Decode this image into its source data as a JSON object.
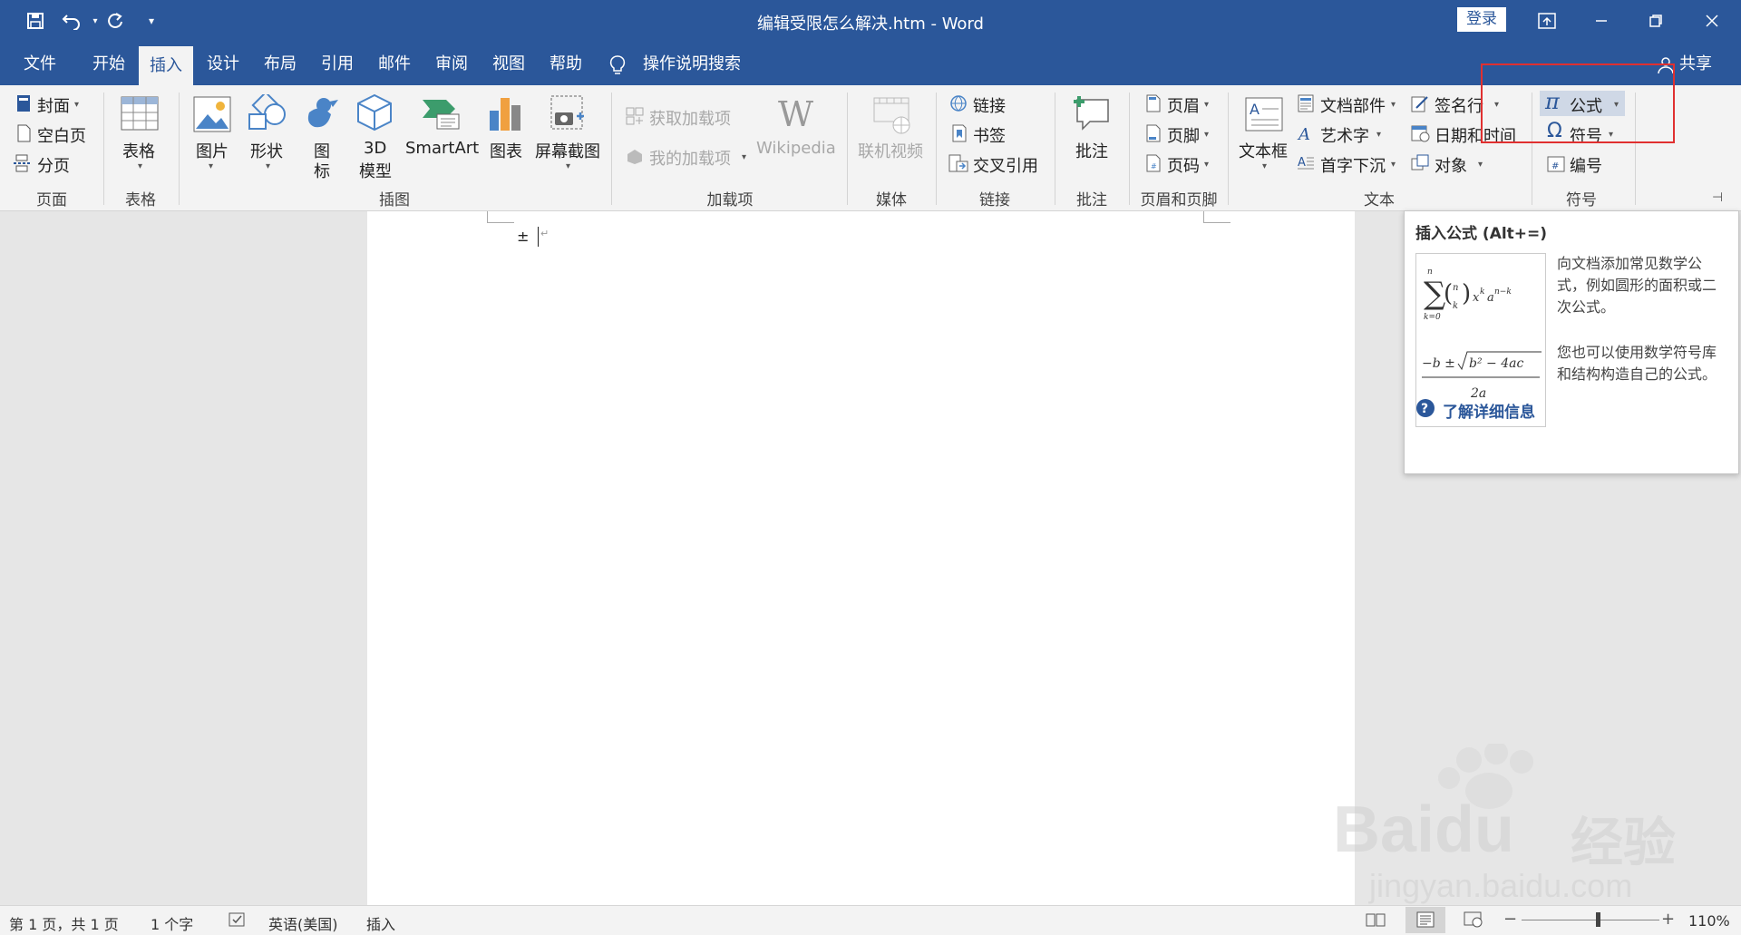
{
  "window": {
    "title": "编辑受限怎么解决.htm  -  Word",
    "login": "登录"
  },
  "tabs": [
    "文件",
    "开始",
    "插入",
    "设计",
    "布局",
    "引用",
    "邮件",
    "审阅",
    "视图",
    "帮助"
  ],
  "active_tab": "插入",
  "tellme": "操作说明搜索",
  "share": "共享",
  "ribbon": {
    "pages": {
      "cover": "封面",
      "blank": "空白页",
      "break": "分页",
      "label": "页面"
    },
    "tables": {
      "table": "表格",
      "label": "表格"
    },
    "illustrations": {
      "pictures": "图片",
      "shapes": "形状",
      "icons1": "图",
      "icons2": "标",
      "model1": "3D",
      "model2": "模型",
      "smartart": "SmartArt",
      "chart": "图表",
      "screenshot": "屏幕截图",
      "label": "插图"
    },
    "addins": {
      "get": "获取加载项",
      "mine": "我的加载项",
      "wikipedia": "Wikipedia",
      "label": "加载项"
    },
    "media": {
      "video": "联机视频",
      "label": "媒体"
    },
    "links": {
      "link": "链接",
      "bookmark": "书签",
      "crossref": "交叉引用",
      "label": "链接"
    },
    "comments": {
      "comment": "批注",
      "label": "批注"
    },
    "headerfooter": {
      "header": "页眉",
      "footer": "页脚",
      "pagenum": "页码",
      "label": "页眉和页脚"
    },
    "text": {
      "textbox": "文本框",
      "quickparts": "文档部件",
      "wordart": "艺术字",
      "dropcap": "首字下沉",
      "signature": "签名行",
      "datetime": "日期和时间",
      "object": "对象",
      "label": "文本"
    },
    "symbols": {
      "equation": "公式",
      "symbol": "符号",
      "number": "编号",
      "label": "符号"
    }
  },
  "document": {
    "content": "±"
  },
  "tooltip": {
    "title": "插入公式 (Alt+=)",
    "desc1": "向文档添加常见数学公式，例如圆形的面积或二次公式。",
    "desc2": "您也可以使用数学符号库和结构构造自己的公式。",
    "learn_more": "了解详细信息"
  },
  "status": {
    "page": "第 1 页，共 1 页",
    "words": "1 个字",
    "language": "英语(美国)",
    "mode": "插入",
    "zoom": "110%",
    "zoom_level": 0.55
  },
  "watermark": {
    "brand": "Baidu",
    "cn": "经验",
    "url": "jingyan.baidu.com"
  },
  "colors": {
    "accent": "#2b579a",
    "highlight": "#e03030"
  }
}
